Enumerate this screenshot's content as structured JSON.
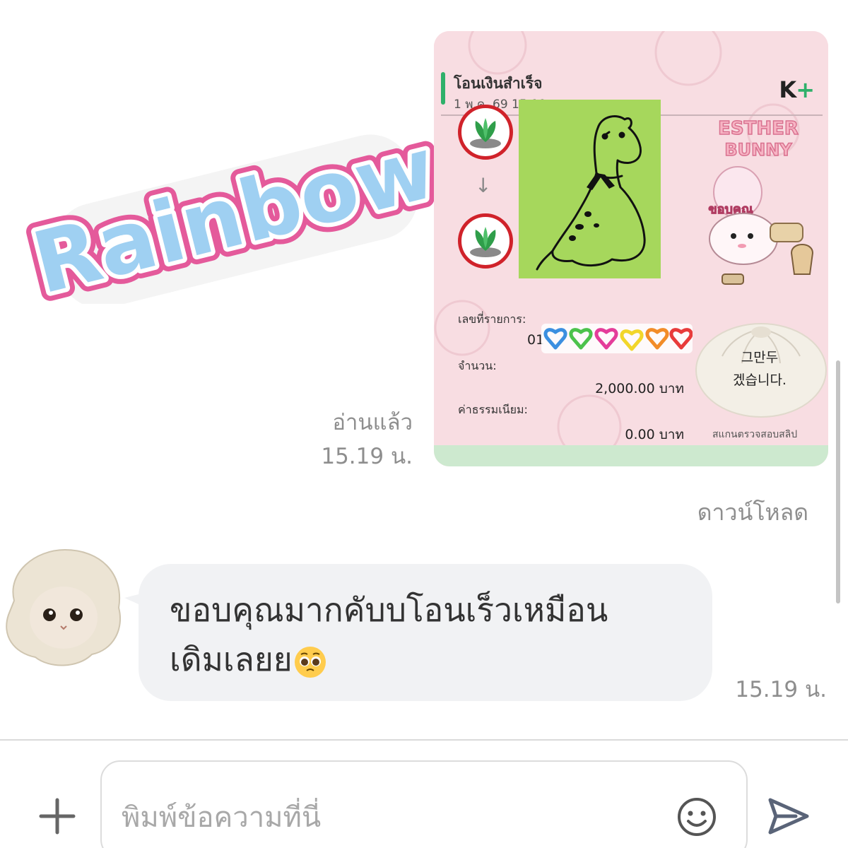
{
  "sticker_rainbow": {
    "text": "Rainbow"
  },
  "slip": {
    "title": "โอนเงินสำเร็จ",
    "datetime": "1 พ.ค. 69  15:19 น.",
    "brand": "K",
    "brand_plus": "+",
    "ref_label": "เลขที่รายการ:",
    "ref_value_prefix": "01",
    "amount_label": "จำนวน:",
    "amount_value": "2,000.00 บาท",
    "fee_label": "ค่าธรรมเนียม:",
    "fee_value": "0.00 บาท",
    "scan_label": "สแกนตรวจสอบสลิป",
    "sticker_esther_line1": "ESTHER",
    "sticker_esther_line2": "BUNNY",
    "sticker_esther_sub": "ขอบคุณ"
  },
  "dumpling_sticker": {
    "line1": "그만두",
    "line2": "겠습니다."
  },
  "read_status": "อ่านแล้ว",
  "sent_time": "15.19 น.",
  "download_label": "ดาวน์โหลด",
  "incoming": {
    "text_line1": "ขอบคุณมากคับบโอนเร็วเหมือน",
    "text_line2": "เดิมเลยย",
    "time": "15.19 น."
  },
  "composer": {
    "placeholder": "พิมพ์ข้อความที่นี่"
  },
  "icons": {
    "plus": "plus-icon",
    "emoji": "smiley-icon",
    "send": "send-icon"
  }
}
